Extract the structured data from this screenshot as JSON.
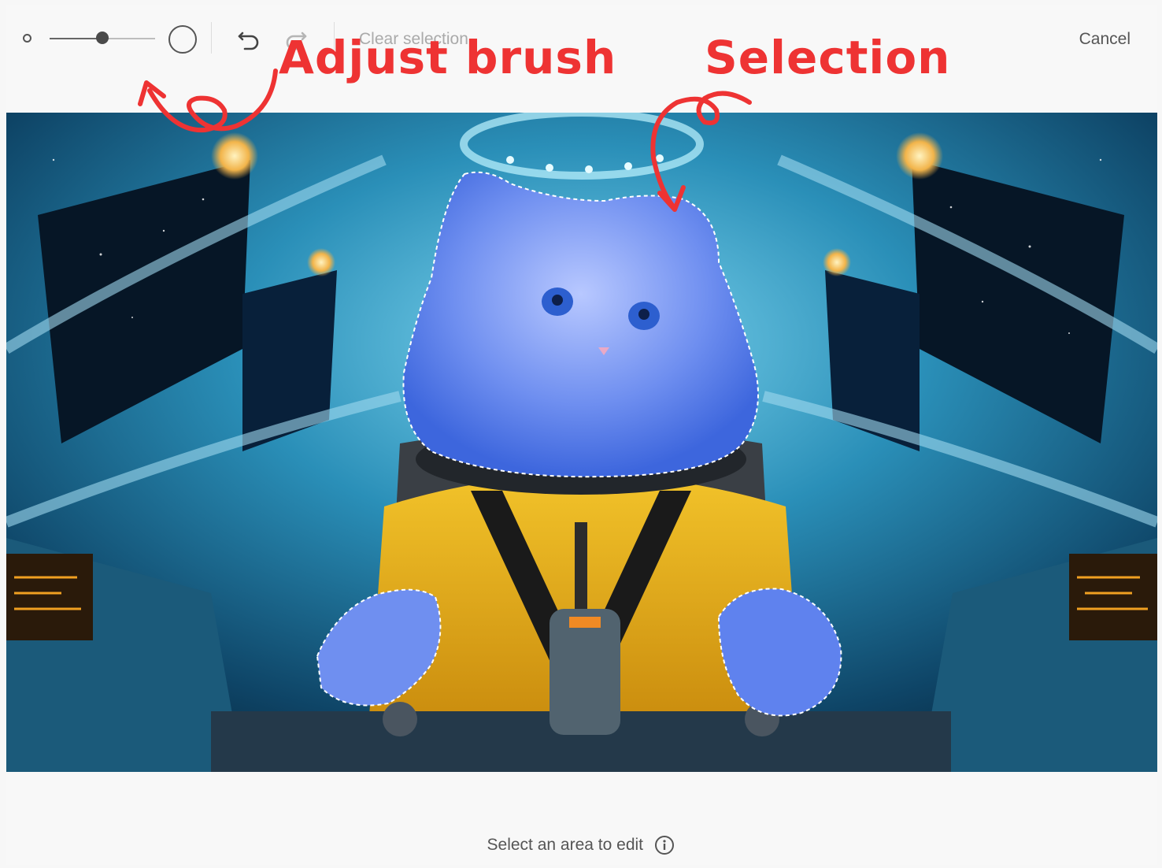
{
  "toolbar": {
    "brush_small_icon": "brush-size-small-icon",
    "brush_large_icon": "brush-size-large-icon",
    "brush_size_level": 0.45,
    "undo_icon": "undo-icon",
    "redo_icon": "redo-icon",
    "clear_selection_label": "Clear selection",
    "cancel_label": "Cancel"
  },
  "annotations": {
    "adjust_brush": "Adjust brush",
    "selection": "Selection",
    "color": "#ee3333"
  },
  "canvas": {
    "image": "astronaut-cat-spaceship-cockpit",
    "selection_color": "#3d6fe6"
  },
  "footer": {
    "hint": "Select an area to edit",
    "info_icon": "info-icon"
  }
}
